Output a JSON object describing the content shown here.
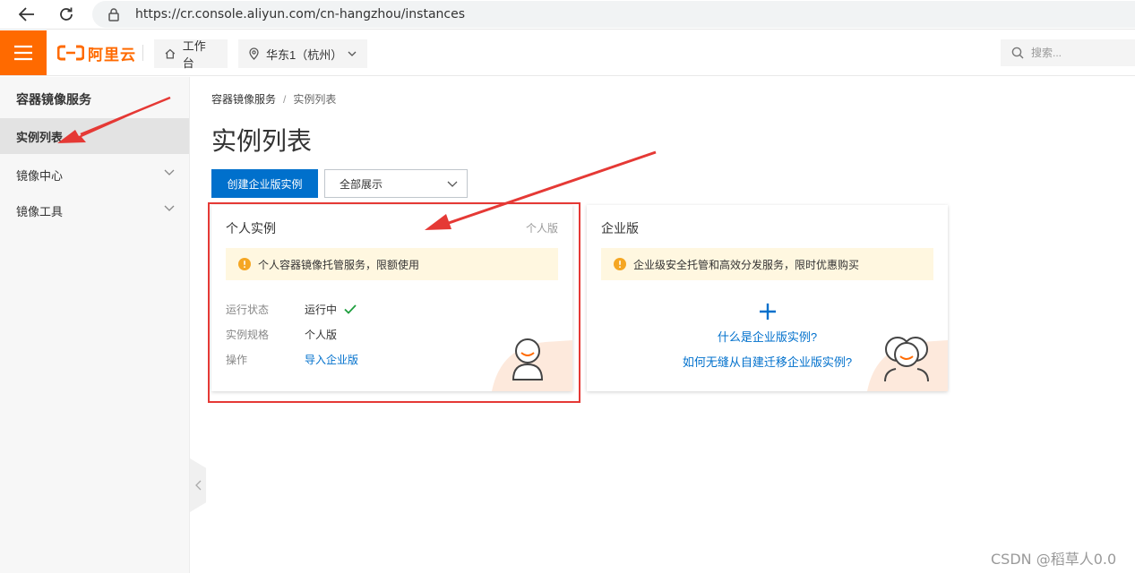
{
  "browser": {
    "url": "https://cr.console.aliyun.com/cn-hangzhou/instances"
  },
  "topbar": {
    "logo_text": "阿里云",
    "workbench_label": "工作台",
    "region_label": "华东1（杭州）",
    "search_placeholder": "搜索..."
  },
  "sidebar": {
    "title": "容器镜像服务",
    "items": [
      {
        "label": "实例列表",
        "active": true
      },
      {
        "label": "镜像中心",
        "expandable": true
      },
      {
        "label": "镜像工具",
        "expandable": true
      }
    ]
  },
  "main": {
    "breadcrumb": [
      "容器镜像服务",
      "实例列表"
    ],
    "breadcrumb_separator": "/",
    "title": "实例列表",
    "create_button": "创建企业版实例",
    "filter_value": "全部展示"
  },
  "cards": {
    "personal": {
      "title": "个人实例",
      "tag": "个人版",
      "notice": "个人容器镜像托管服务，限额使用",
      "rows": [
        {
          "label": "运行状态",
          "value": "运行中"
        },
        {
          "label": "实例规格",
          "value": "个人版"
        },
        {
          "label": "操作",
          "value": "导入企业版"
        }
      ]
    },
    "enterprise": {
      "title": "企业版",
      "notice": "企业级安全托管和高效分发服务，限时优惠购买",
      "link1": "什么是企业版实例?",
      "link2": "如何无缝从自建迁移企业版实例?"
    }
  },
  "watermark": "CSDN @稻草人0.0",
  "colors": {
    "brand": "#ff6a00",
    "primary": "#0070cc",
    "notice_bg": "#fff7e0",
    "warning": "#f5a623",
    "success": "#1e9e3e",
    "annotation": "#e53935"
  }
}
